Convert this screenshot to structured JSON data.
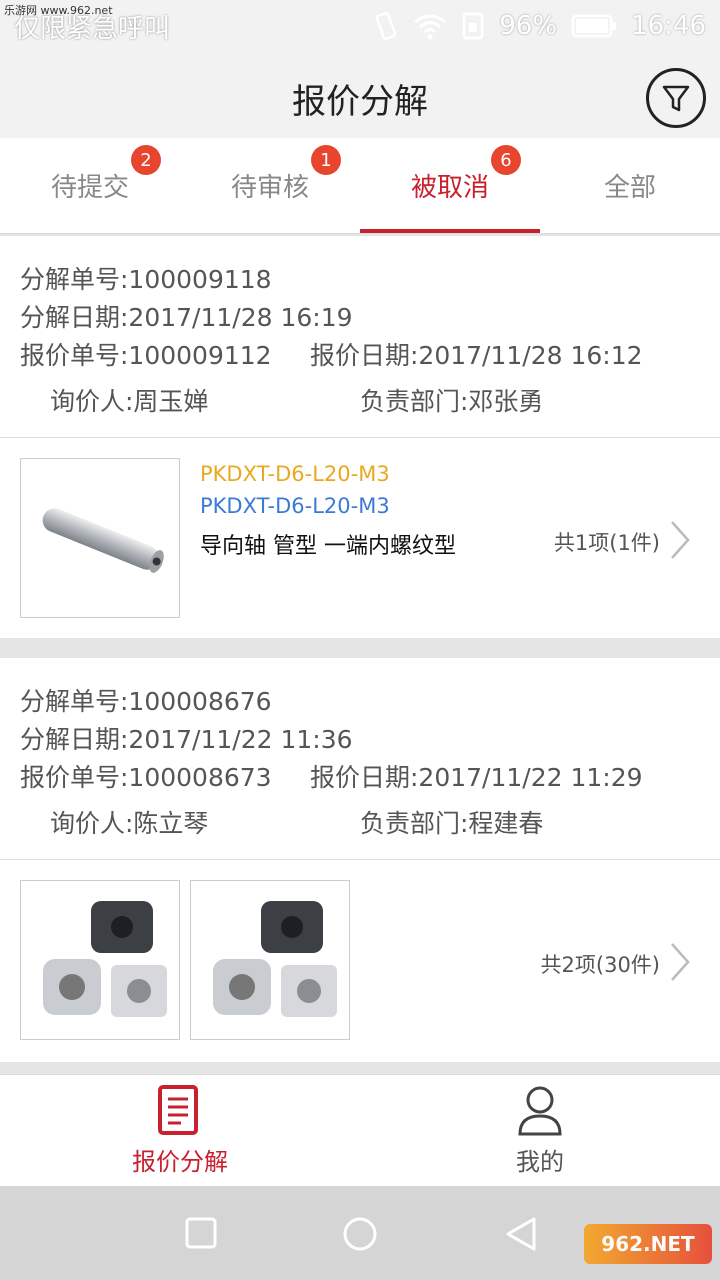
{
  "status_bar": {
    "watermark": "乐游网 www.962.net",
    "emergency_text": "仅限紧急呼叫",
    "battery": "96%",
    "time": "16:46"
  },
  "header": {
    "title": "报价分解"
  },
  "tabs": [
    {
      "label": "待提交",
      "badge": "2"
    },
    {
      "label": "待审核",
      "badge": "1"
    },
    {
      "label": "被取消",
      "badge": "6"
    },
    {
      "label": "全部",
      "badge": ""
    }
  ],
  "cards": [
    {
      "decomp_no": "分解单号:100009118",
      "decomp_date": "分解日期:2017/11/28 16:19",
      "quote_no": "报价单号:100009112",
      "quote_date": "报价日期:2017/11/28 16:12",
      "inquirer": "询价人:周玉婵",
      "dept": "负责部门:邓张勇",
      "product_code": "PKDXT-D6-L20-M3",
      "product_code2": "PKDXT-D6-L20-M3",
      "product_name": "导向轴 管型 一端内螺纹型",
      "count": "共1项(1件)"
    },
    {
      "decomp_no": "分解单号:100008676",
      "decomp_date": "分解日期:2017/11/22 11:36",
      "quote_no": "报价单号:100008673",
      "quote_date": "报价日期:2017/11/22 11:29",
      "inquirer": "询价人:陈立琴",
      "dept": "负责部门:程建春",
      "count": "共2项(30件)"
    }
  ],
  "bottom_nav": [
    {
      "label": "报价分解",
      "icon": "document-icon"
    },
    {
      "label": "我的",
      "icon": "person-icon"
    }
  ],
  "system_watermark": "962.NET",
  "colors": {
    "accent": "#c8202e",
    "badge": "#e8452f",
    "code_orange": "#e8a920",
    "code_blue": "#3b7bd6"
  }
}
